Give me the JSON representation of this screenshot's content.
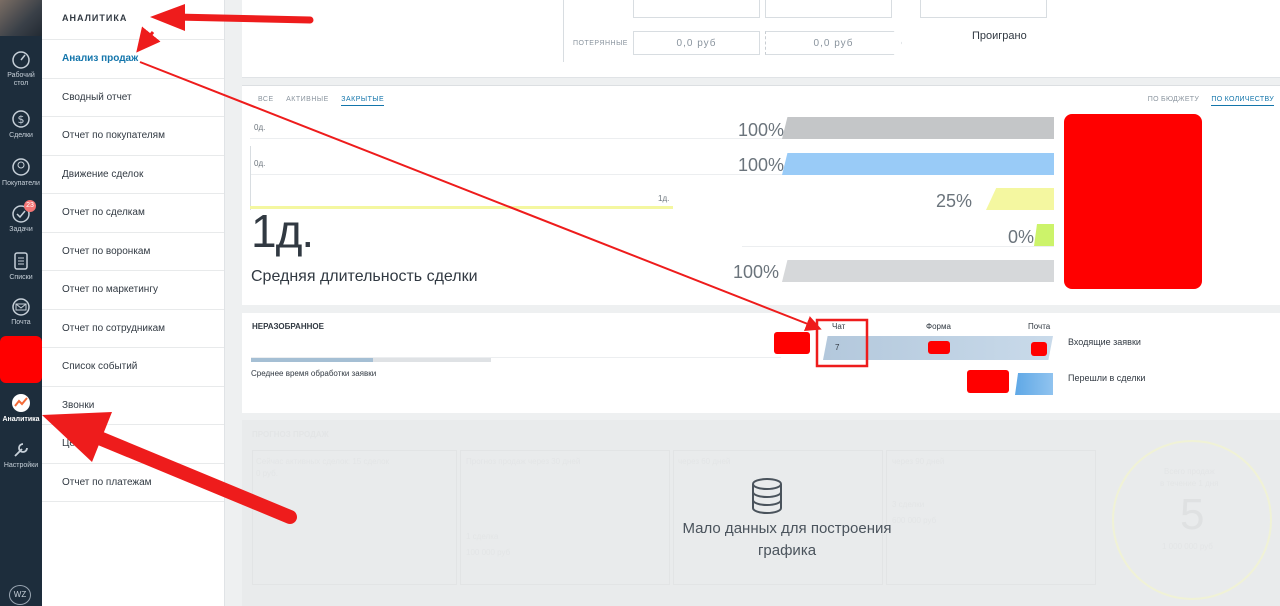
{
  "nav": {
    "items": [
      {
        "label": "Рабочий стол",
        "icon": "dashboard-icon"
      },
      {
        "label": "Сделки",
        "icon": "dollar-icon"
      },
      {
        "label": "Покупатели",
        "icon": "customers-icon"
      },
      {
        "label": "Задачи",
        "icon": "check-icon",
        "badge": "23"
      },
      {
        "label": "Списки",
        "icon": "lists-icon"
      },
      {
        "label": "Почта",
        "icon": "mail-icon"
      },
      {
        "label": "Аналитика",
        "icon": "analytics-icon"
      },
      {
        "label": "Настройки",
        "icon": "settings-icon"
      }
    ],
    "logo": "WZ"
  },
  "submenu": {
    "title": "АНАЛИТИКА",
    "items": [
      "Анализ продаж",
      "Сводный отчет",
      "Отчет по покупателям",
      "Движение сделок",
      "Отчет по сделкам",
      "Отчет по воронкам",
      "Отчет по маркетингу",
      "Отчет по сотрудникам",
      "Список событий",
      "Звонки",
      "Цел",
      "Отчет по платежам"
    ]
  },
  "top": {
    "lost_label": "ПОТЕРЯННЫЕ",
    "lost_value_1": "0,0 руб",
    "lost_value_2": "0,0 руб",
    "status": "Проиграно"
  },
  "funnel": {
    "tabs": [
      "ВСЕ",
      "АКТИВНЫЕ",
      "ЗАКРЫТЫЕ"
    ],
    "active_tab": "ЗАКРЫТЫЕ",
    "mode_tabs": [
      "ПО БЮДЖЕТУ",
      "ПО КОЛИЧЕСТВУ"
    ],
    "active_mode": "ПО КОЛИЧЕСТВУ",
    "timeline_labels": [
      "0д.",
      "0д.",
      "1д."
    ],
    "avg_duration": "1д.",
    "avg_duration_label": "Средняя длительность сделки",
    "bars": [
      {
        "pct": "100%",
        "color": "#c4c6c8",
        "fill": 1.0
      },
      {
        "pct": "100%",
        "color": "#99cbf7",
        "fill": 1.0
      },
      {
        "pct": "25%",
        "color": "#f4f7a0",
        "fill": 0.25
      },
      {
        "pct": "0%",
        "color": "#ccf36a",
        "fill": 0.0
      },
      {
        "pct": "100%",
        "color": "#d6d8da",
        "fill": 1.0
      }
    ]
  },
  "requests": {
    "title": "НЕРАЗОБРАННОЕ",
    "avg_time_label": "Среднее время обработки заявки",
    "avg_time_progress": 0.51,
    "channels": [
      "Чат",
      "Форма",
      "Почта"
    ],
    "chat_value": "7",
    "incoming_label": "Входящие заявки",
    "converted_label": "Перешли в сделки"
  },
  "forecast": {
    "title": "ПРОГНОЗ ПРОДАЖ",
    "col1": "Сейчас активных сделок: 15 сделок",
    "col1b": "0 руб.",
    "col2": "Прогноз продаж через 30 дней",
    "col2a": "1 сделка",
    "col2b": "100 000 руб",
    "col3": "через 60 дней",
    "col4": "через 90 дней",
    "col4a": "3 сделки",
    "col4b": "600 000 руб",
    "total_label": "Всего продаж",
    "total_sub": "в течение 1 дня",
    "total_value": "5",
    "total_money": "1 000 000 руб",
    "no_data": "Мало данных для построения графика"
  }
}
